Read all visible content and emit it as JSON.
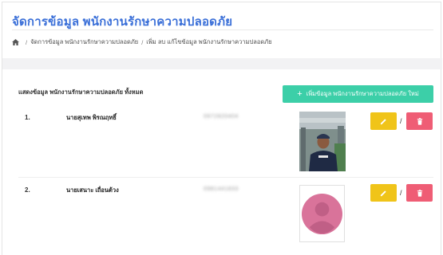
{
  "page": {
    "title": "จัดการข้อมูล พนักงานรักษาความปลอดภัย"
  },
  "breadcrumb": {
    "home_icon": "home-icon",
    "items": [
      "จัดการข้อมูล พนักงานรักษาความปลอดภัย",
      "เพิ่ม ลบ แก้ไขข้อมูล พนักงานรักษาความปลอดภัย"
    ],
    "separator": "/"
  },
  "section": {
    "label": "แสดงข้อมูล พนักงานรักษาความปลอดภัย ทั้งหมด",
    "add_button_label": "เพิ่มข้อมูล พนักงานรักษาความปลอดภัย ใหม่",
    "add_button_icon": "plus-icon"
  },
  "rows": [
    {
      "number": "1.",
      "name": "นายสุเทพ พิรณฤทธิ์",
      "phone": "0972820404",
      "photo": "staff-photo",
      "action_separator": "/"
    },
    {
      "number": "2.",
      "name": "นายเสนาะ เถื่อนต้วง",
      "phone": "0981441833",
      "photo": "default-avatar",
      "action_separator": "/"
    }
  ],
  "colors": {
    "title": "#3a6fd8",
    "add_button": "#3ccfa8",
    "edit_button": "#f0c419",
    "delete_button": "#ef5d75",
    "avatar": "#d9739a"
  }
}
